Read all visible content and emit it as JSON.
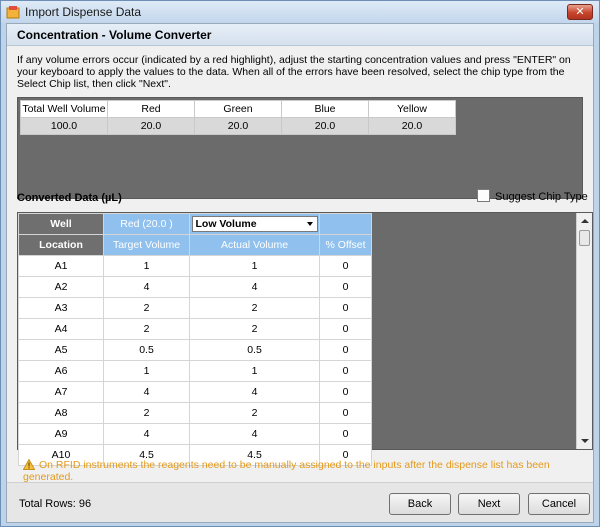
{
  "window": {
    "title": "Import Dispense Data",
    "close_label": "✕"
  },
  "header": {
    "title": "Concentration - Volume Converter"
  },
  "instructions": "If any volume errors occur (indicated by a red highlight), adjust the starting concentration values and press \"ENTER\" on your keyboard to apply the values to the data. When all of the errors have been resolved, select the chip type from the Select Chip list, then click \"Next\".",
  "concentration": {
    "headers": [
      "Total Well Volume",
      "Red",
      "Green",
      "Blue",
      "Yellow"
    ],
    "values": [
      "100.0",
      "20.0",
      "20.0",
      "20.0",
      "20.0"
    ]
  },
  "converted": {
    "label": "Converted Data (µL)",
    "suggest_label": "Suggest Chip Type",
    "header_top": {
      "well": "Well",
      "reagent": "Red (20.0 )",
      "chip_select": "Low Volume"
    },
    "header_sub": {
      "location": "Location",
      "target": "Target Volume",
      "actual": "Actual Volume",
      "offset": "% Offset"
    },
    "rows": [
      {
        "loc": "A1",
        "target": "1",
        "actual": "1",
        "offset": "0"
      },
      {
        "loc": "A2",
        "target": "4",
        "actual": "4",
        "offset": "0"
      },
      {
        "loc": "A3",
        "target": "2",
        "actual": "2",
        "offset": "0"
      },
      {
        "loc": "A4",
        "target": "2",
        "actual": "2",
        "offset": "0"
      },
      {
        "loc": "A5",
        "target": "0.5",
        "actual": "0.5",
        "offset": "0"
      },
      {
        "loc": "A6",
        "target": "1",
        "actual": "1",
        "offset": "0"
      },
      {
        "loc": "A7",
        "target": "4",
        "actual": "4",
        "offset": "0"
      },
      {
        "loc": "A8",
        "target": "2",
        "actual": "2",
        "offset": "0"
      },
      {
        "loc": "A9",
        "target": "4",
        "actual": "4",
        "offset": "0"
      },
      {
        "loc": "A10",
        "target": "4.5",
        "actual": "4.5",
        "offset": "0"
      }
    ]
  },
  "warning": "On RFID instruments the reagents need to be manually assigned to the inputs after the dispense list has been generated.",
  "footer": {
    "total_rows": "Total Rows:  96",
    "back": "Back",
    "next": "Next",
    "cancel": "Cancel"
  },
  "colors": {
    "accent_blue": "#8fc0ee",
    "warning_orange": "#e39a1c",
    "close_red": "#c8452d"
  },
  "icons": {
    "title": "app-icon",
    "warning": "warning-triangle-icon",
    "close": "close-icon"
  }
}
